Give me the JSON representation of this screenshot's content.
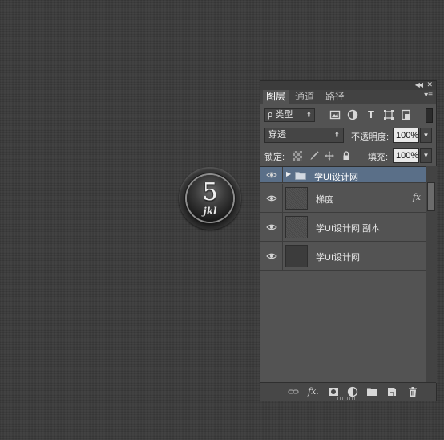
{
  "keypad": {
    "digit": "5",
    "letters": "jkl"
  },
  "panel": {
    "tabs": [
      {
        "label": "图层",
        "active": true
      },
      {
        "label": "通道",
        "active": false
      },
      {
        "label": "路径",
        "active": false
      }
    ],
    "filter": {
      "label": "ρ 类型"
    },
    "blend_mode": "穿透",
    "opacity_label": "不透明度:",
    "opacity_value": "100%",
    "lock_label": "锁定:",
    "fill_label": "填充:",
    "fill_value": "100%",
    "layers": [
      {
        "name": "学UI设计网",
        "type": "group",
        "selected": true
      },
      {
        "name": "梯度",
        "type": "layer",
        "fx": "fx"
      },
      {
        "name": "学UI设计网 副本",
        "type": "layer"
      },
      {
        "name": "学UI设计网",
        "type": "layer"
      }
    ],
    "bottom_fx_label": "fx."
  },
  "colors": {
    "canvas": "#3a3a3a",
    "panel": "#535353",
    "selected_layer": "#5a6f88"
  }
}
